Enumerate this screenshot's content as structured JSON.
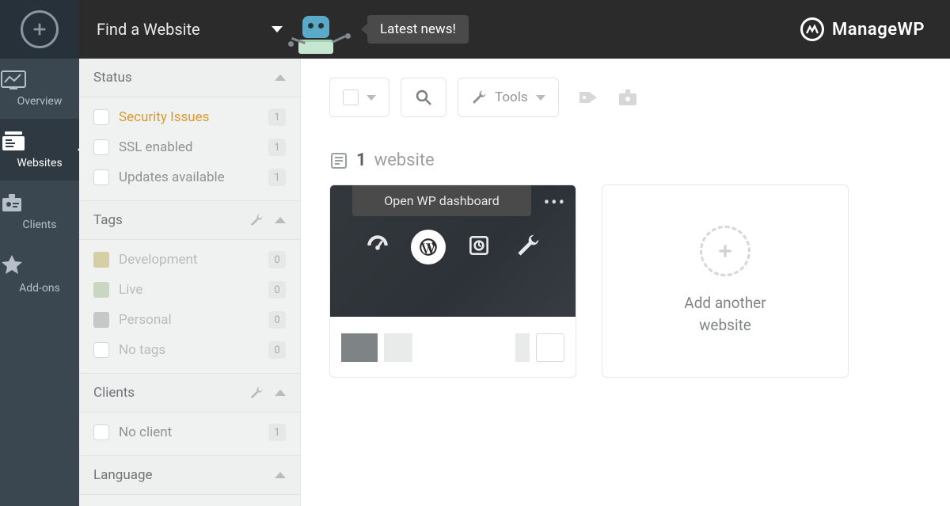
{
  "brand": {
    "name": "ManageWP"
  },
  "topbar": {
    "find_label": "Find a Website",
    "news_label": "Latest news!"
  },
  "leftnav": {
    "items": [
      {
        "label": "Overview"
      },
      {
        "label": "Websites"
      },
      {
        "label": "Clients"
      },
      {
        "label": "Add-ons"
      }
    ]
  },
  "filters": {
    "status": {
      "title": "Status",
      "items": [
        {
          "label": "Security Issues",
          "count": "1"
        },
        {
          "label": "SSL enabled",
          "count": "1"
        },
        {
          "label": "Updates available",
          "count": "1"
        }
      ]
    },
    "tags": {
      "title": "Tags",
      "items": [
        {
          "label": "Development",
          "count": "0",
          "color": "#d6cfa6"
        },
        {
          "label": "Live",
          "count": "0",
          "color": "#c9d7c0"
        },
        {
          "label": "Personal",
          "count": "0",
          "color": "#c7c7c7"
        },
        {
          "label": "No tags",
          "count": "0",
          "checkbox": true
        }
      ]
    },
    "clients": {
      "title": "Clients",
      "items": [
        {
          "label": "No client",
          "count": "1"
        }
      ]
    },
    "language": {
      "title": "Language"
    }
  },
  "toolbar": {
    "tools_label": "Tools"
  },
  "summary": {
    "count": "1",
    "unit": "website"
  },
  "card": {
    "tooltip": "Open WP dashboard"
  },
  "addcard": {
    "line1": "Add another",
    "line2": "website"
  }
}
